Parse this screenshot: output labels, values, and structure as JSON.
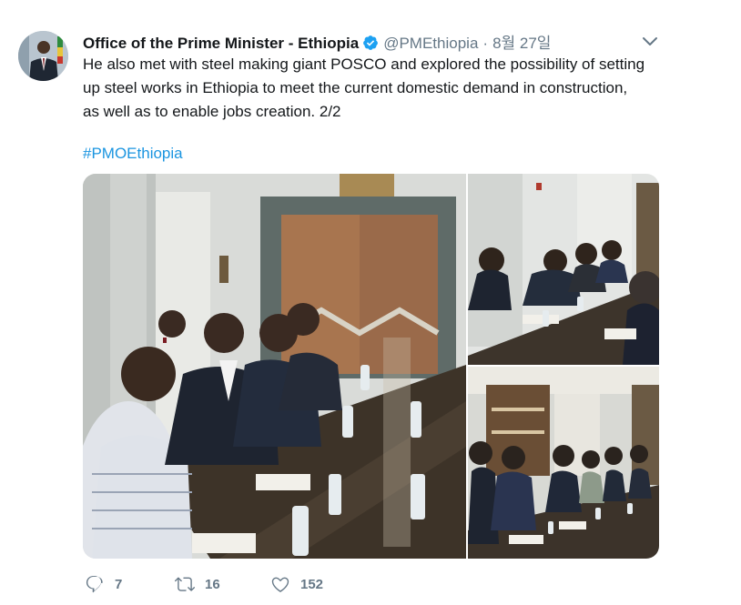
{
  "tweet": {
    "author_name": "Office of the Prime Minister - Ethiopia",
    "handle": "@PMEthiopia",
    "separator": "·",
    "date": "8월 27일",
    "text": "He also met with steel making giant POSCO and explored the possibility of setting up steel works in Ethiopia to meet the current domestic demand in construction, as well as to enable jobs creation. 2/2",
    "hashtag": "#PMOEthiopia"
  },
  "stats": {
    "replies": "7",
    "retweets": "16",
    "likes": "152"
  },
  "icons": {
    "verified": "verified-badge-icon",
    "caret": "chevron-down-icon",
    "reply": "reply-icon",
    "retweet": "retweet-icon",
    "like": "heart-icon"
  },
  "colors": {
    "name": "#14171a",
    "secondary": "#657786",
    "link": "#1b95e0",
    "verified": "#1da1f2"
  }
}
